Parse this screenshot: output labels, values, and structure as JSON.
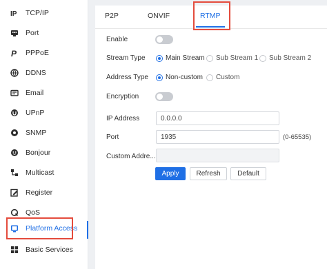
{
  "sidebar": {
    "items": [
      {
        "label": "TCP/IP",
        "icon": "ip-icon"
      },
      {
        "label": "Port",
        "icon": "port-icon"
      },
      {
        "label": "PPPoE",
        "icon": "pppoe-icon"
      },
      {
        "label": "DDNS",
        "icon": "ddns-icon"
      },
      {
        "label": "Email",
        "icon": "email-icon"
      },
      {
        "label": "UPnP",
        "icon": "upnp-icon"
      },
      {
        "label": "SNMP",
        "icon": "snmp-icon"
      },
      {
        "label": "Bonjour",
        "icon": "bonjour-icon"
      },
      {
        "label": "Multicast",
        "icon": "multicast-icon"
      },
      {
        "label": "Register",
        "icon": "register-icon"
      },
      {
        "label": "QoS",
        "icon": "qos-icon"
      },
      {
        "label": "Platform Access",
        "icon": "platform-access-icon",
        "active": true
      },
      {
        "label": "Basic Services",
        "icon": "basic-services-icon"
      }
    ]
  },
  "tabs": [
    {
      "label": "P2P"
    },
    {
      "label": "ONVIF"
    },
    {
      "label": "RTMP",
      "active": true
    }
  ],
  "form": {
    "enable_label": "Enable",
    "enable_on": false,
    "stream_type_label": "Stream Type",
    "stream_options": [
      "Main Stream",
      "Sub Stream 1",
      "Sub Stream 2"
    ],
    "stream_selected": "Main Stream",
    "address_type_label": "Address Type",
    "address_options": [
      "Non-custom",
      "Custom"
    ],
    "address_selected": "Non-custom",
    "encryption_label": "Encryption",
    "encryption_on": false,
    "ip_label": "IP Address",
    "ip_value": "0.0.0.0",
    "port_label": "Port",
    "port_value": "1935",
    "port_hint": "(0-65535)",
    "custom_address_label": "Custom Addre...",
    "custom_address_value": ""
  },
  "buttons": {
    "apply": "Apply",
    "refresh": "Refresh",
    "default": "Default"
  },
  "colors": {
    "accent": "#1f6fe5",
    "highlight": "#e44b3c"
  }
}
